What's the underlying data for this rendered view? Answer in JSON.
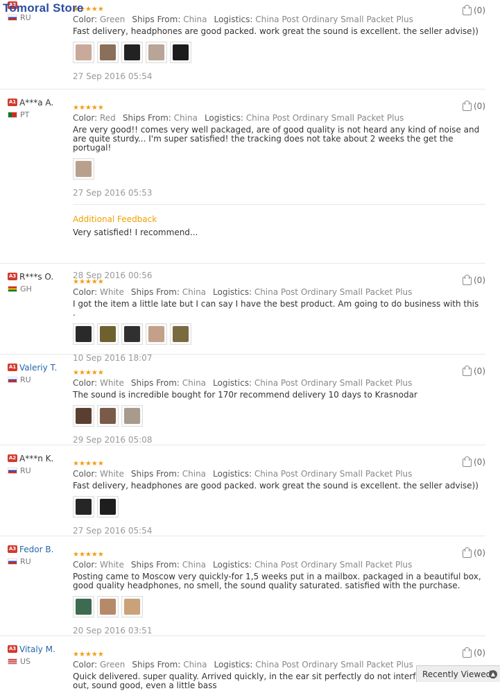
{
  "store": {
    "name": "Tomoral Store"
  },
  "helpful_icon": "thumbs-up-icon",
  "labels": {
    "color": "Color:",
    "ships_from": "Ships From:",
    "logistics": "Logistics:"
  },
  "reviews": [
    {
      "level": "A2",
      "user": "",
      "user_link": false,
      "country": "RU",
      "flag": "ru",
      "stars": 5,
      "color": "Green",
      "ships_from": "China",
      "logistics": "China Post Ordinary Small Packet Plus",
      "text": "Fast delivery, headphones are good packed. work great the sound is excellent. the seller advise))",
      "thumbs": [
        "#c9a99a",
        "#8a6f5a",
        "#222222",
        "#b8a597",
        "#1c1c1c"
      ],
      "date": "27 Sep 2016 05:54",
      "helpful": "(0)"
    },
    {
      "level": "A1",
      "user": "A***a A.",
      "user_link": false,
      "country": "PT",
      "flag": "pt",
      "stars": 5,
      "color": "Red",
      "ships_from": "China",
      "logistics": "China Post Ordinary Small Packet Plus",
      "text": "Are very good!! comes very well packaged, are of good quality is not heard any kind of noise and are quite sturdy... I'm super satisfied! the tracking does not take about 2 weeks the get the portugal!",
      "thumbs": [
        "#b9a08d"
      ],
      "date": "27 Sep 2016 05:53",
      "helpful": "(0)",
      "additional": {
        "title": "Additional Feedback",
        "text": "Very satisfied! I recommend...",
        "date": "28 Sep 2016 00:56"
      }
    },
    {
      "level": "A3",
      "user": "R***s O.",
      "user_link": false,
      "country": "GH",
      "flag": "gh",
      "stars": 5,
      "color": "White",
      "ships_from": "China",
      "logistics": "China Post Ordinary Small Packet Plus",
      "text": "I got the item a little late but I can say I have the best product. Am going to do business with this .",
      "thumbs": [
        "#2a2a2a",
        "#6f6030",
        "#303030",
        "#c2a08a",
        "#7a6a40"
      ],
      "date": "10 Sep 2016 18:07",
      "helpful": "(0)"
    },
    {
      "level": "A1",
      "user": "Valeriy T.",
      "user_link": true,
      "country": "RU",
      "flag": "ru",
      "stars": 5,
      "color": "White",
      "ships_from": "China",
      "logistics": "China Post Ordinary Small Packet Plus",
      "text": "The sound is incredible bought for 170r recommend delivery 10 days to Krasnodar",
      "thumbs": [
        "#5a3e30",
        "#7a5a48",
        "#a89a8c"
      ],
      "date": "29 Sep 2016 05:08",
      "helpful": "(0)"
    },
    {
      "level": "A2",
      "user": "A***n K.",
      "user_link": false,
      "country": "RU",
      "flag": "ru",
      "stars": 5,
      "color": "White",
      "ships_from": "China",
      "logistics": "China Post Ordinary Small Packet Plus",
      "text": "Fast delivery, headphones are good packed. work great the sound is excellent. the seller advise))",
      "thumbs": [
        "#262626",
        "#1e1e1e"
      ],
      "date": "27 Sep 2016 05:54",
      "helpful": "(0)"
    },
    {
      "level": "A3",
      "user": "Fedor B.",
      "user_link": true,
      "country": "RU",
      "flag": "ru",
      "stars": 5,
      "color": "White",
      "ships_from": "China",
      "logistics": "China Post Ordinary Small Packet Plus",
      "text": "Posting came to Moscow very quickly-for 1,5 weeks put in a mailbox. packaged in a beautiful box, good quality headphones, no smell, the sound quality saturated. satisfied with the purchase.",
      "thumbs": [
        "#3e6a52",
        "#b58a6a",
        "#c9a27a"
      ],
      "date": "20 Sep 2016 03:51",
      "helpful": "(0)"
    },
    {
      "level": "A3",
      "user": "Vitaly M.",
      "user_link": true,
      "country": "US",
      "flag": "us",
      "stars": 5,
      "color": "Green",
      "ships_from": "China",
      "logistics": "China Post Ordinary Small Packet Plus",
      "text": "Quick delivered. super quality. Arrived quickly, in the ear sit perfectly do not interfere, do not fall out, sound good, even a little bass",
      "thumbs": [],
      "date": "",
      "helpful": "(0)"
    }
  ],
  "recently_viewed": {
    "label": "Recently Viewed",
    "icon": "chevron-up-icon"
  }
}
